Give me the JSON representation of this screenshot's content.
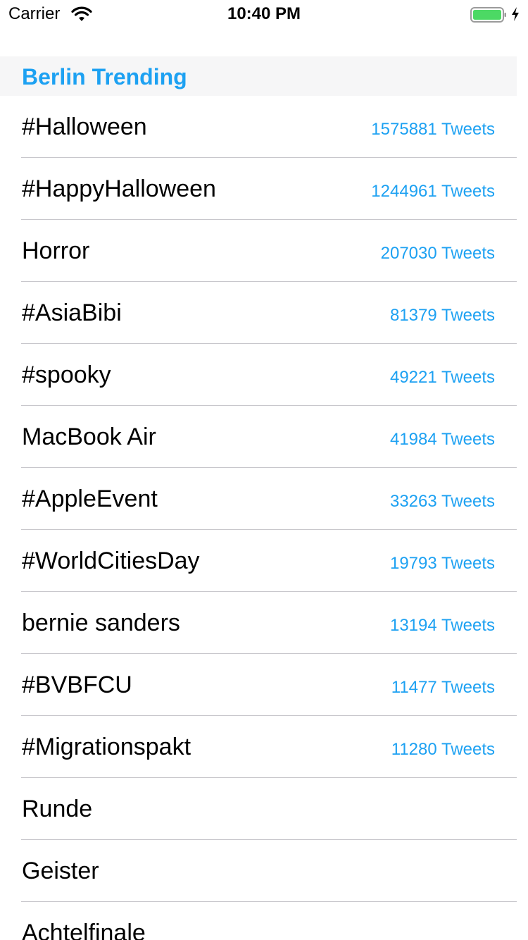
{
  "status_bar": {
    "carrier": "Carrier",
    "time": "10:40 PM",
    "battery_color": "#4cd964"
  },
  "section": {
    "title": "Berlin Trending",
    "accent": "#1da1f2"
  },
  "trends": [
    {
      "name": "#Halloween",
      "count": "1575881 Tweets"
    },
    {
      "name": "#HappyHalloween",
      "count": "1244961 Tweets"
    },
    {
      "name": "Horror",
      "count": "207030 Tweets"
    },
    {
      "name": "#AsiaBibi",
      "count": "81379 Tweets"
    },
    {
      "name": "#spooky",
      "count": "49221 Tweets"
    },
    {
      "name": "MacBook Air",
      "count": "41984 Tweets"
    },
    {
      "name": "#AppleEvent",
      "count": "33263 Tweets"
    },
    {
      "name": "#WorldCitiesDay",
      "count": "19793 Tweets"
    },
    {
      "name": "bernie sanders",
      "count": "13194 Tweets"
    },
    {
      "name": "#BVBFCU",
      "count": "11477 Tweets"
    },
    {
      "name": "#Migrationspakt",
      "count": "11280 Tweets"
    },
    {
      "name": "Runde",
      "count": ""
    },
    {
      "name": "Geister",
      "count": ""
    },
    {
      "name": "Achtelfinale",
      "count": ""
    }
  ]
}
